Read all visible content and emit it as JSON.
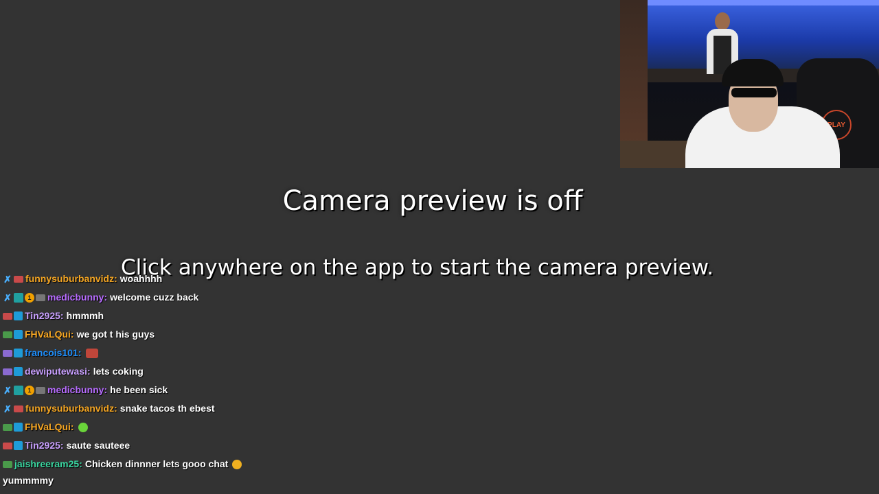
{
  "preview": {
    "title": "Camera preview is off",
    "subtitle": "Click anywhere on the app to start the camera preview."
  },
  "webcam": {
    "chair_logo": "PLAY"
  },
  "chat": {
    "messages": [
      {
        "user": "funnysuburbanvidz",
        "sep": ":",
        "text": "woahhhh",
        "color": "#f5a623"
      },
      {
        "user": "medicbunny",
        "sep": ":",
        "text": "welcome cuzz back",
        "color": "#b76cff"
      },
      {
        "user": "Tin2925",
        "sep": ":",
        "text": "hmmmh",
        "color": "#c9a0ff"
      },
      {
        "user": "FHVaLQui",
        "sep": ":",
        "text": "we got t his guys",
        "color": "#f5a623"
      },
      {
        "user": "francois101",
        "sep": ":",
        "text": "",
        "emote": "emote-red",
        "color": "#1e90ff"
      },
      {
        "user": "dewiputewasi",
        "sep": ":",
        "text": "lets coking",
        "color": "#c9a0ff"
      },
      {
        "user": "medicbunny",
        "sep": ":",
        "text": "he been sick",
        "color": "#b76cff"
      },
      {
        "user": "funnysuburbanvidz",
        "sep": ":",
        "text": "snake tacos th ebest",
        "color": "#f5a623"
      },
      {
        "user": "FHVaLQui",
        "sep": ":",
        "text": "",
        "emote": "emote-green",
        "color": "#f5a623"
      },
      {
        "user": "Tin2925",
        "sep": ":",
        "text": "saute sauteee",
        "color": "#c9a0ff"
      },
      {
        "user": "jaishreeram25",
        "sep": ":",
        "text": "Chicken dinnner lets gooo chat",
        "emote": "emote-face",
        "color": "#39d6a0"
      }
    ],
    "wrapped_text": "yummmmy"
  }
}
